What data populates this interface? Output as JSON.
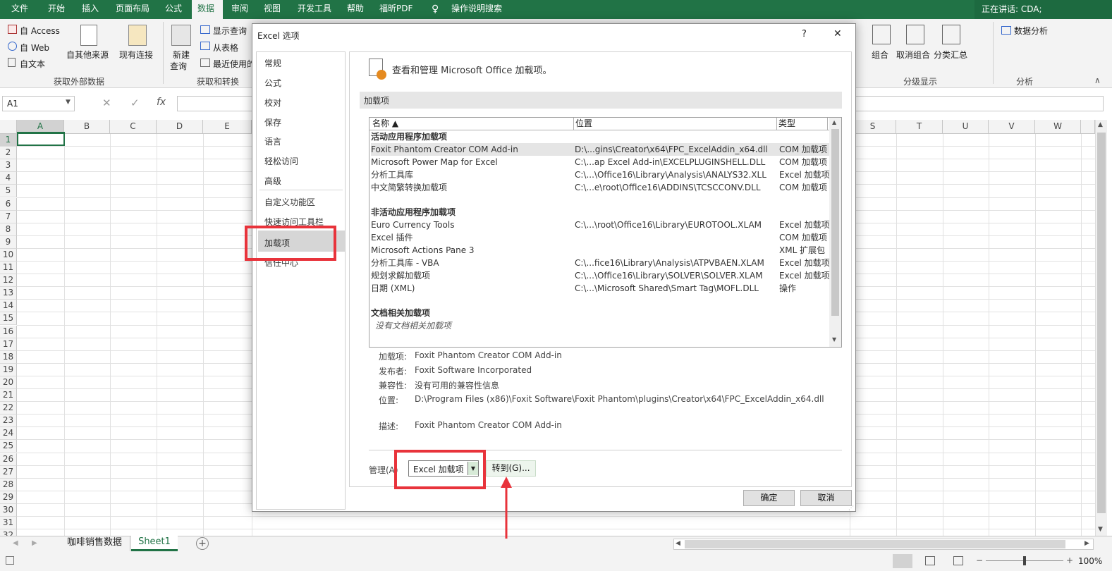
{
  "tabs": [
    "文件",
    "开始",
    "插入",
    "页面布局",
    "公式",
    "数据",
    "审阅",
    "视图",
    "开发工具",
    "帮助",
    "福昕PDF",
    "操作说明搜索"
  ],
  "active_tab": "数据",
  "speaking": "正在讲话: CDA;",
  "ribbon": {
    "access": "自 Access",
    "web": "自 Web",
    "text": "自文本",
    "other_sources": "自其他来源",
    "existing_conn": "现有连接",
    "group_external": "获取外部数据",
    "new_query": "新建",
    "new_query2": "查询",
    "show_query": "显示查询",
    "from_table": "从表格",
    "recent": "最近使用的",
    "group_transform": "获取和转换",
    "group": "组合",
    "ungroup": "取消组合",
    "subtotal": "分类汇总",
    "group_outline": "分级显示",
    "data_analysis": "数据分析",
    "group_analysis": "分析"
  },
  "formula_bar": {
    "namebox": "A1",
    "fx": "fx"
  },
  "columns": [
    "A",
    "B",
    "C",
    "D",
    "E",
    "S",
    "T",
    "U",
    "V",
    "W"
  ],
  "rows": [
    "1",
    "2",
    "3",
    "4",
    "5",
    "6",
    "7",
    "8",
    "9",
    "10",
    "11",
    "12",
    "13",
    "14",
    "15",
    "16",
    "17",
    "18",
    "19",
    "20",
    "21",
    "22",
    "23",
    "24",
    "25",
    "26",
    "27",
    "28",
    "29",
    "30",
    "31",
    "32"
  ],
  "sheets": [
    "咖啡销售数据",
    "Sheet1"
  ],
  "status": {
    "zoom": "100%"
  },
  "dialog": {
    "title": "Excel 选项",
    "help": "?",
    "close": "✕",
    "nav": [
      "常规",
      "公式",
      "校对",
      "保存",
      "语言",
      "轻松访问",
      "高级",
      "自定义功能区",
      "快速访问工具栏",
      "加载项",
      "信任中心"
    ],
    "nav_selected": "加载项",
    "header": "查看和管理 Microsoft Office 加载项。",
    "section": "加载项",
    "col_name": "名称 ▲",
    "col_location": "位置",
    "col_type": "类型",
    "group_active": "活动应用程序加载项",
    "active": [
      {
        "name": "Foxit Phantom Creator COM Add-in",
        "loc": "D:\\...gins\\Creator\\x64\\FPC_ExcelAddin_x64.dll",
        "type": "COM 加载项"
      },
      {
        "name": "Microsoft Power Map for Excel",
        "loc": "C:\\...ap Excel Add-in\\EXCELPLUGINSHELL.DLL",
        "type": "COM 加载项"
      },
      {
        "name": "分析工具库",
        "loc": "C:\\...\\Office16\\Library\\Analysis\\ANALYS32.XLL",
        "type": "Excel 加载项"
      },
      {
        "name": "中文简繁转换加载项",
        "loc": "C:\\...e\\root\\Office16\\ADDINS\\TCSCCONV.DLL",
        "type": "COM 加载项"
      }
    ],
    "group_inactive": "非活动应用程序加载项",
    "inactive": [
      {
        "name": "Euro Currency Tools",
        "loc": "C:\\...\\root\\Office16\\Library\\EUROTOOL.XLAM",
        "type": "Excel 加载项"
      },
      {
        "name": "Excel 插件",
        "loc": "",
        "type": "COM 加载项"
      },
      {
        "name": "Microsoft Actions Pane 3",
        "loc": "",
        "type": "XML 扩展包"
      },
      {
        "name": "分析工具库 - VBA",
        "loc": "C:\\...fice16\\Library\\Analysis\\ATPVBAEN.XLAM",
        "type": "Excel 加载项"
      },
      {
        "name": "规划求解加载项",
        "loc": "C:\\...\\Office16\\Library\\SOLVER\\SOLVER.XLAM",
        "type": "Excel 加载项"
      },
      {
        "name": "日期 (XML)",
        "loc": "C:\\...\\Microsoft Shared\\Smart Tag\\MOFL.DLL",
        "type": "操作"
      }
    ],
    "group_doc": "文档相关加载项",
    "doc_none": "没有文档相关加载项",
    "detail": {
      "addin_label": "加载项:",
      "addin": "Foxit Phantom Creator COM Add-in",
      "publisher_label": "发布者:",
      "publisher": "Foxit Software Incorporated",
      "compat_label": "兼容性:",
      "compat": "没有可用的兼容性信息",
      "location_label": "位置:",
      "location": "D:\\Program Files (x86)\\Foxit Software\\Foxit Phantom\\plugins\\Creator\\x64\\FPC_ExcelAddin_x64.dll",
      "desc_label": "描述:",
      "desc": "Foxit Phantom Creator COM Add-in"
    },
    "manage_label": "管理(A):",
    "manage_value": "Excel 加载项",
    "goto": "转到(G)...",
    "ok": "确定",
    "cancel": "取消"
  },
  "colors": {
    "excel_green": "#217346",
    "highlight_red": "#e8333b"
  }
}
